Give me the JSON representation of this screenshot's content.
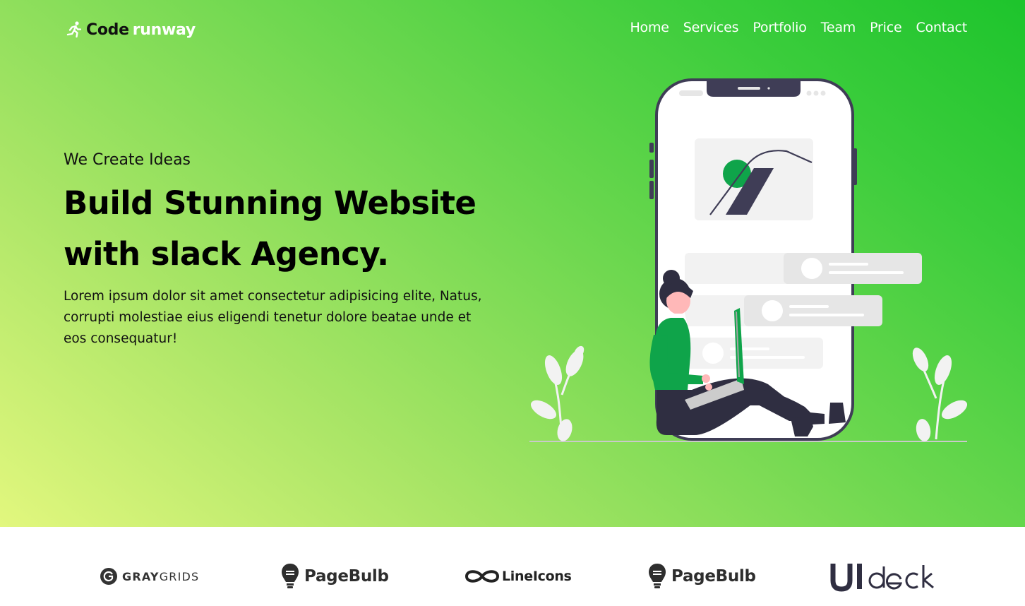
{
  "header": {
    "logo": {
      "word1": "Code",
      "word2": "runway",
      "icon": "running-person-icon"
    },
    "nav": [
      {
        "label": "Home"
      },
      {
        "label": "Services"
      },
      {
        "label": "Portfolio"
      },
      {
        "label": "Team"
      },
      {
        "label": "Price"
      },
      {
        "label": "Contact"
      }
    ]
  },
  "hero": {
    "eyebrow": "We Create Ideas",
    "headline_line1": "Build Stunning Website",
    "headline_line2": "with slack Agency.",
    "description": "Lorem ipsum dolor sit amet consectetur adipisicing elite, Natus, corrupti molestiae eius eligendi tenetur dolore beataе unde et eos consequatur!",
    "illustration": "woman-with-laptop-sitting-by-phone-illustration"
  },
  "brands": [
    {
      "name": "graygrids",
      "part1": "GRAY",
      "part2": "GRIDS",
      "icon": "graygrids-logo-icon"
    },
    {
      "name": "pagebulb",
      "label": "PageBulb",
      "icon": "lightbulb-icon"
    },
    {
      "name": "lineicons",
      "label": "LineIcons",
      "icon": "infinity-icon"
    },
    {
      "name": "pagebulb-2",
      "label": "PageBulb",
      "icon": "lightbulb-icon"
    },
    {
      "name": "uideck",
      "label": "UIdeck",
      "icon": "uideck-logo"
    }
  ],
  "colors": {
    "gradient_start": "#e2f77e",
    "gradient_end": "#1dc42c",
    "accent_green": "#0fa44a",
    "dark": "#2f2e41"
  }
}
